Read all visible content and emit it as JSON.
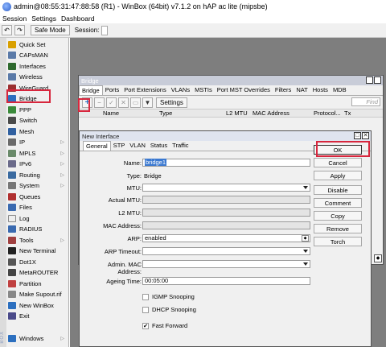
{
  "titlebar": {
    "title": "admin@08:55:31:47:88:58 (R1) - WinBox (64bit) v7.1.2 on hAP ac lite (mipsbe)"
  },
  "menu": [
    "Session",
    "Settings",
    "Dashboard"
  ],
  "toolbar": {
    "undo": "↶",
    "redo": "↷",
    "safe_mode": "Safe Mode",
    "session_label": "Session:"
  },
  "sidebar": {
    "strip_text": "BOX",
    "items": [
      {
        "label": "Quick Set",
        "icon": "quick-set-icon",
        "color": "#d9a000",
        "arrow": ""
      },
      {
        "label": "CAPsMAN",
        "icon": "capsman-icon",
        "color": "#5a7aa8",
        "arrow": ""
      },
      {
        "label": "Interfaces",
        "icon": "interfaces-icon",
        "color": "#2f6a2f",
        "arrow": ""
      },
      {
        "label": "Wireless",
        "icon": "wireless-icon",
        "color": "#5a7aa8",
        "arrow": ""
      },
      {
        "label": "WireGuard",
        "icon": "wireguard-icon",
        "color": "#9a3030",
        "arrow": ""
      },
      {
        "label": "Bridge",
        "icon": "bridge-icon",
        "color": "#2c6fbf",
        "arrow": ""
      },
      {
        "label": "PPP",
        "icon": "ppp-icon",
        "color": "#3a8a3a",
        "arrow": ""
      },
      {
        "label": "Switch",
        "icon": "switch-icon",
        "color": "#4a4a4a",
        "arrow": ""
      },
      {
        "label": "Mesh",
        "icon": "mesh-icon",
        "color": "#3060a0",
        "arrow": ""
      },
      {
        "label": "IP",
        "icon": "ip-icon",
        "color": "#6a6a6a",
        "arrow": "▷"
      },
      {
        "label": "MPLS",
        "icon": "mpls-icon",
        "color": "#6a8a6a",
        "arrow": "▷"
      },
      {
        "label": "IPv6",
        "icon": "ipv6-icon",
        "color": "#6a6a8a",
        "arrow": "▷"
      },
      {
        "label": "Routing",
        "icon": "routing-icon",
        "color": "#3a6aa0",
        "arrow": "▷"
      },
      {
        "label": "System",
        "icon": "system-icon",
        "color": "#777777",
        "arrow": "▷"
      },
      {
        "label": "Queues",
        "icon": "queues-icon",
        "color": "#b03030",
        "arrow": ""
      },
      {
        "label": "Files",
        "icon": "files-icon",
        "color": "#3a6ab0",
        "arrow": ""
      },
      {
        "label": "Log",
        "icon": "log-icon",
        "color": "#eeeeee",
        "arrow": ""
      },
      {
        "label": "RADIUS",
        "icon": "radius-icon",
        "color": "#3a6ab0",
        "arrow": ""
      },
      {
        "label": "Tools",
        "icon": "tools-icon",
        "color": "#a04040",
        "arrow": "▷"
      },
      {
        "label": "New Terminal",
        "icon": "terminal-icon",
        "color": "#222222",
        "arrow": ""
      },
      {
        "label": "Dot1X",
        "icon": "dot1x-icon",
        "color": "#555555",
        "arrow": ""
      },
      {
        "label": "MetaROUTER",
        "icon": "metarouter-icon",
        "color": "#444444",
        "arrow": ""
      },
      {
        "label": "Partition",
        "icon": "partition-icon",
        "color": "#c04040",
        "arrow": ""
      },
      {
        "label": "Make Supout.rif",
        "icon": "supout-icon",
        "color": "#888888",
        "arrow": ""
      },
      {
        "label": "New WinBox",
        "icon": "winbox-icon",
        "color": "#2c6fbf",
        "arrow": ""
      },
      {
        "label": "Exit",
        "icon": "exit-icon",
        "color": "#4a4a8a",
        "arrow": ""
      }
    ],
    "windows": {
      "label": "Windows",
      "icon": "windows-icon",
      "arrow": "▷"
    }
  },
  "bridge_window": {
    "title": "Bridge",
    "tabs": [
      "Bridge",
      "Ports",
      "Port Extensions",
      "VLANs",
      "MSTIs",
      "Port MST Overrides",
      "Filters",
      "NAT",
      "Hosts",
      "MDB"
    ],
    "settings_button": "Settings",
    "find_placeholder": "Find",
    "columns": [
      "Name",
      "Type",
      "L2 MTU",
      "MAC Address",
      "Protocol...",
      "Tx"
    ],
    "add_icon": "+",
    "remove_icon": "−"
  },
  "new_interface": {
    "title": "New Interface",
    "tabs": [
      "General",
      "STP",
      "VLAN",
      "Status",
      "Traffic"
    ],
    "fields": {
      "name": {
        "label": "Name:",
        "value": "bridge1"
      },
      "type": {
        "label": "Type:",
        "value": "Bridge"
      },
      "mtu": {
        "label": "MTU:",
        "value": ""
      },
      "actual_mtu": {
        "label": "Actual MTU:",
        "value": ""
      },
      "l2_mtu": {
        "label": "L2 MTU:",
        "value": ""
      },
      "mac": {
        "label": "MAC Address:",
        "value": ""
      },
      "arp": {
        "label": "ARP:",
        "value": "enabled"
      },
      "arp_timeout": {
        "label": "ARP Timeout:",
        "value": ""
      },
      "admin_mac": {
        "label": "Admin. MAC Address:",
        "value": ""
      },
      "ageing": {
        "label": "Ageing Time:",
        "value": "00:05:00"
      }
    },
    "checkboxes": {
      "igmp": {
        "label": "IGMP Snooping",
        "checked": false
      },
      "dhcp": {
        "label": "DHCP Snooping",
        "checked": false
      },
      "fast_forward": {
        "label": "Fast Forward",
        "checked": true,
        "mark": "✔"
      }
    },
    "buttons": [
      "OK",
      "Cancel",
      "Apply",
      "Disable",
      "Comment",
      "Copy",
      "Remove",
      "Torch"
    ]
  }
}
